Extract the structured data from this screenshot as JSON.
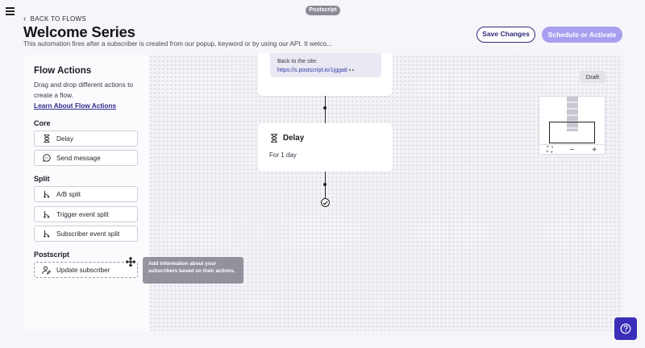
{
  "app": {
    "brand": "Postscript"
  },
  "header": {
    "back_label": "BACK TO FLOWS",
    "title": "Welcome Series",
    "subtitle": "This automation fires after a subscriber is created from our popup, keyword or by using our API. It welco...",
    "save_label": "Save Changes",
    "schedule_label": "Schedule or Activate"
  },
  "sidebar": {
    "title": "Flow Actions",
    "description": "Drag and drop different actions to create a flow.",
    "link": "Learn About Flow Actions",
    "sections": [
      {
        "title": "Core",
        "items": [
          {
            "label": "Delay",
            "icon": "hourglass-icon"
          },
          {
            "label": "Send message",
            "icon": "chat-bubble-icon"
          }
        ]
      },
      {
        "title": "Split",
        "items": [
          {
            "label": "A/B split",
            "icon": "branch-icon"
          },
          {
            "label": "Trigger event split",
            "icon": "branch-icon"
          },
          {
            "label": "Subscriber event split",
            "icon": "branch-icon"
          }
        ]
      },
      {
        "title": "Postscript",
        "items": [
          {
            "label": "Update subscriber",
            "icon": "user-edit-icon"
          }
        ]
      }
    ]
  },
  "tooltip": {
    "text": "Add information about your subscribers based on their actions."
  },
  "canvas": {
    "status": "Draft",
    "message_node": {
      "line1": "Back to the site:",
      "line2": "https://s.postscript.io/1jgga8 👀"
    },
    "delay_node": {
      "title": "Delay",
      "detail": "For 1 day"
    },
    "minimap_controls": [
      "⛶",
      "−",
      "+"
    ]
  },
  "colors": {
    "primary": "#2e2a7a",
    "primary_light": "#a99ff0",
    "help_button": "#3a2fb8"
  }
}
